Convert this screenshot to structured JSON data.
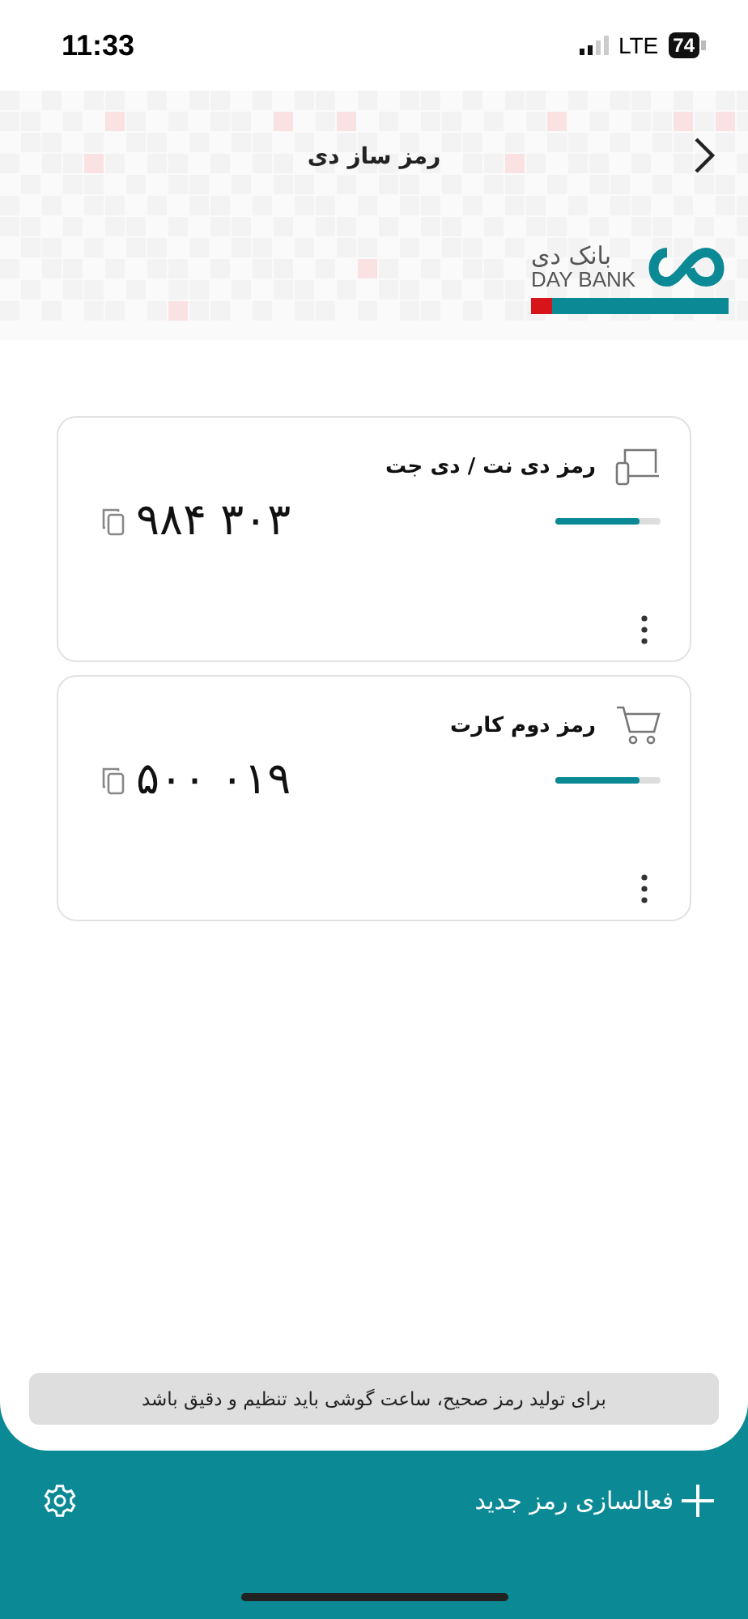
{
  "status_bar": {
    "time": "11:33",
    "network": "LTE",
    "battery": "74"
  },
  "header": {
    "title": "رمز ساز دی"
  },
  "logo": {
    "name_fa": "بانک دی",
    "name_en": "DAY BANK"
  },
  "cards": [
    {
      "kind": "device",
      "title": "رمز دی نت / دی جت",
      "code": "۹۸۴ ۳۰۳",
      "level": 0.8
    },
    {
      "kind": "cart",
      "title": "رمز دوم کارت",
      "code": "۵۰۰ ۰۱۹",
      "level": 0.8
    }
  ],
  "notice": "برای تولید رمز صحیح، ساعت گوشی باید تنظیم و دقیق باشد",
  "footer": {
    "action": "فعالسازی رمز جدید"
  }
}
